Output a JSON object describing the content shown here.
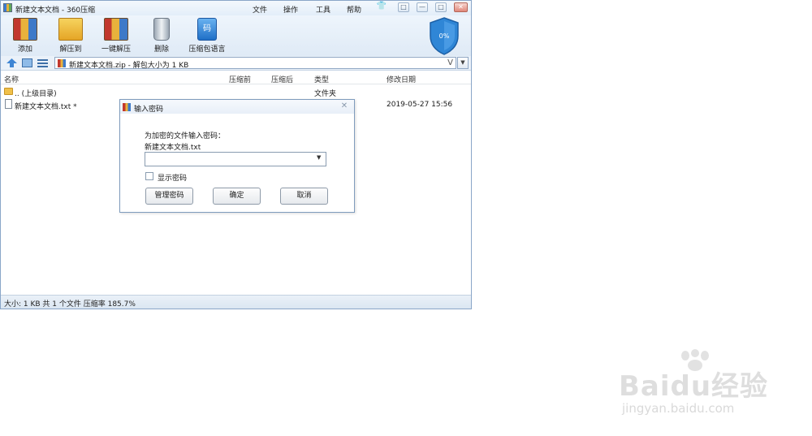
{
  "window": {
    "title": "新建文本文档 - 360压缩",
    "menu": [
      "文件",
      "操作",
      "工具",
      "帮助"
    ],
    "controls": [
      "shirt-icon",
      "chat-icon",
      "minimize-icon",
      "maximize-icon",
      "close-icon"
    ]
  },
  "toolbar": {
    "add": "添加",
    "extract_to": "解压到",
    "one_click_extract": "一键解压",
    "delete": "删除",
    "language": "压缩包语言",
    "language_icon_text": "码",
    "shield_text": "0%"
  },
  "address": {
    "path": "新建文本文档.zip - 解包大小为 1 KB",
    "v_mark": "V"
  },
  "columns": {
    "name": "名称",
    "compressed_before": "压缩前",
    "compressed_after": "压缩后",
    "type": "类型",
    "modified": "修改日期"
  },
  "rows": [
    {
      "name": ".. (上级目录)",
      "type": "文件夹",
      "modified": ""
    },
    {
      "name": "新建文本文档.txt *",
      "type": "",
      "modified": "2019-05-27 15:56"
    }
  ],
  "status": "大小: 1 KB 共 1 个文件 压缩率 185.7%",
  "dialog": {
    "title": "输入密码",
    "prompt": "为加密的文件输入密码：",
    "filename": "新建文本文档.txt",
    "password_value": "",
    "show_password_label": "显示密码",
    "show_password_checked": false,
    "manage_button": "管理密码",
    "ok_button": "确定",
    "cancel_button": "取消"
  },
  "watermark": {
    "brand": "Baidu经验",
    "url": "jingyan.baidu.com"
  },
  "colors": {
    "accent": "#3d79c8",
    "shield": "#2f86d6",
    "titlebar": "#e3eef9"
  }
}
